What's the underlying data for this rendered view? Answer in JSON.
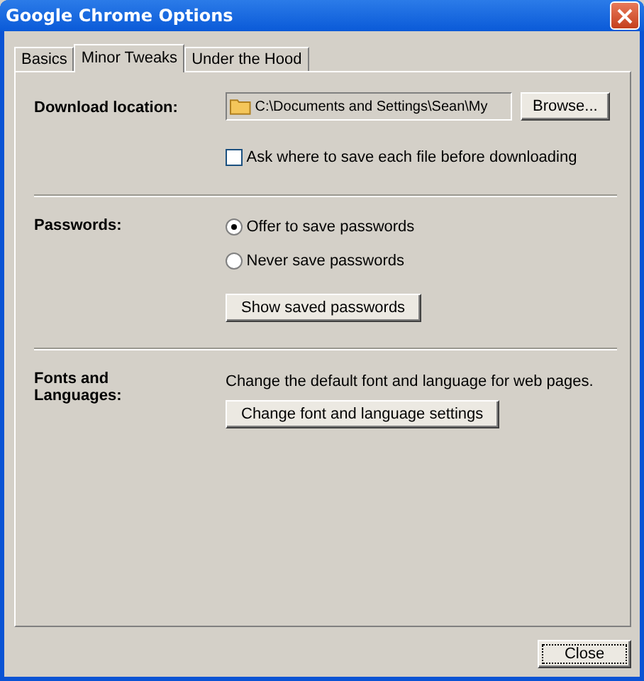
{
  "window": {
    "title": "Google Chrome Options"
  },
  "tabs": [
    {
      "label": "Basics",
      "selected": false
    },
    {
      "label": "Minor Tweaks",
      "selected": true
    },
    {
      "label": "Under the Hood",
      "selected": false
    }
  ],
  "download": {
    "label": "Download location:",
    "path": "C:\\Documents and Settings\\Sean\\My",
    "browse_button": "Browse...",
    "ask_checkbox": {
      "label": "Ask where to save each file before downloading",
      "checked": false
    }
  },
  "passwords": {
    "label": "Passwords:",
    "options": [
      {
        "label": "Offer to save passwords",
        "selected": true
      },
      {
        "label": "Never save passwords",
        "selected": false
      }
    ],
    "button": "Show saved passwords"
  },
  "fonts": {
    "label": "Fonts and Languages:",
    "description": "Change the default font and language for web pages.",
    "button": "Change font and language settings"
  },
  "close_button": "Close"
}
